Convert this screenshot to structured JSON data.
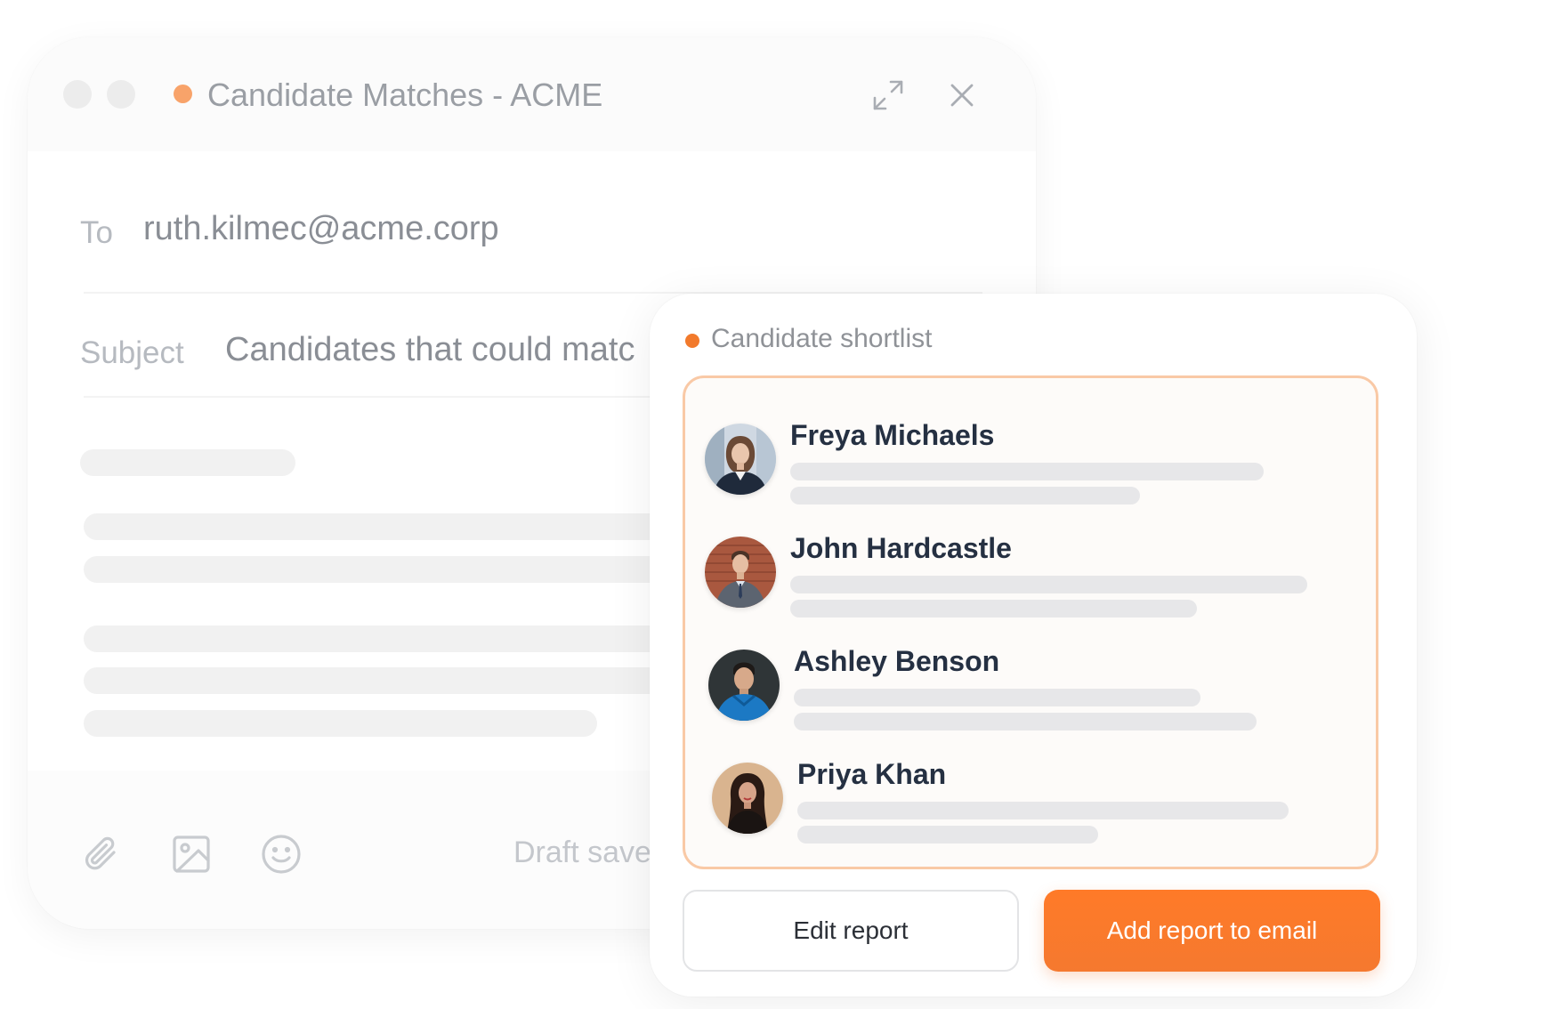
{
  "compose": {
    "title": "Candidate Matches - ACME",
    "to_label": "To",
    "to_value": "ruth.kilmec@acme.corp",
    "subject_label": "Subject",
    "subject_value": "Candidates that could matc",
    "draft_status": "Draft save",
    "icons": [
      "expand-icon",
      "close-icon",
      "paperclip-icon",
      "image-icon",
      "emoji-icon"
    ]
  },
  "shortlist": {
    "title": "Candidate shortlist",
    "candidates": [
      {
        "name": "Freya Michaels"
      },
      {
        "name": "John Hardcastle"
      },
      {
        "name": "Ashley Benson"
      },
      {
        "name": "Priya Khan"
      }
    ],
    "edit_label": "Edit report",
    "add_label": "Add report to email"
  },
  "colors": {
    "accent": "#ff7a28",
    "status_dot": "#f8a36a",
    "list_border": "#f9c9a6",
    "name_text": "#253042"
  }
}
